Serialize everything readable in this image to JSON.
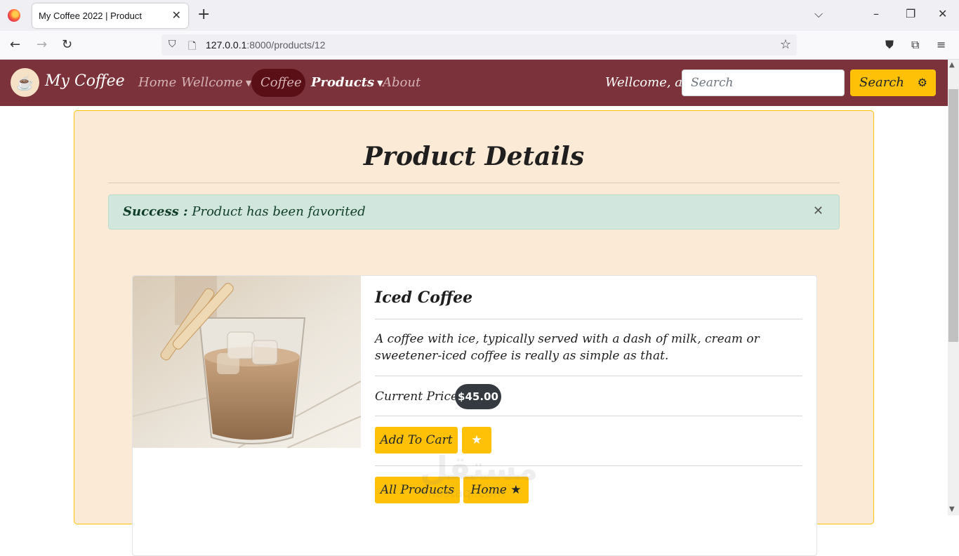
{
  "browser": {
    "tab_title": "My Coffee 2022 | Product",
    "url_host": "127.0.0.1",
    "url_path": ":8000/products/12"
  },
  "nav": {
    "brand": "My Coffee",
    "links": [
      "Home",
      "Wellcome",
      "Coffee",
      "Products",
      "About"
    ],
    "welcome": "Wellcome, ali",
    "search_placeholder": "Search",
    "search_button": "Search"
  },
  "page": {
    "title": "Product Details",
    "alert_label": "Success :",
    "alert_message": "Product has been favorited"
  },
  "product": {
    "name": "Iced Coffee",
    "description": "A coffee with ice, typically served with a dash of milk, cream or sweetener-iced coffee is really as simple as that.",
    "price_label": "Current Price:",
    "price": "$45.00",
    "add_to_cart": "Add To Cart",
    "all_products": "All Products",
    "home": "Home"
  },
  "watermark": {
    "main": "مستقل",
    "sub": "mostaql.com"
  },
  "colors": {
    "nav_bg": "#7b323b",
    "accent": "#ffc107",
    "panel_bg": "#faead6",
    "alert_bg": "#d1e7dd"
  }
}
